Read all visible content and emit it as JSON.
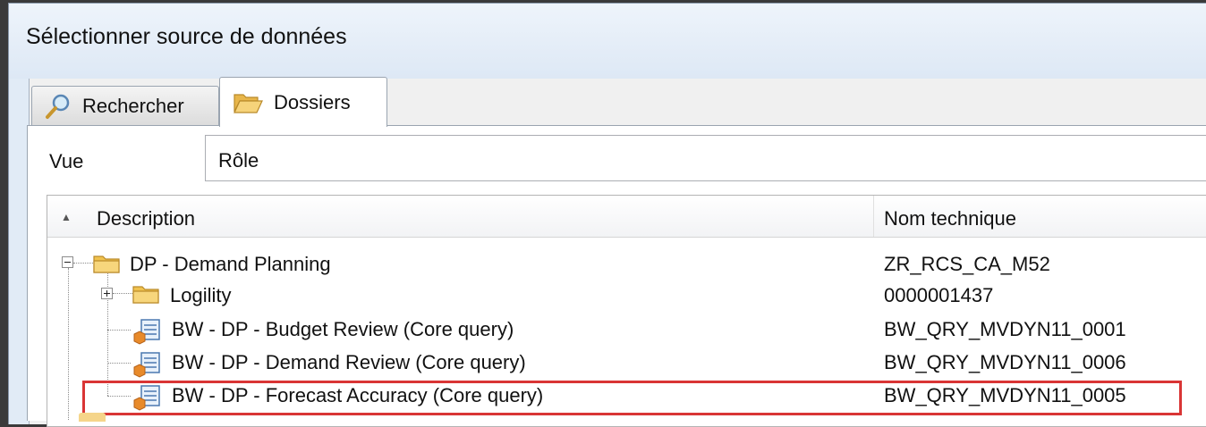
{
  "window": {
    "title": "Sélectionner source de données"
  },
  "tabs": [
    {
      "label": "Rechercher",
      "icon": "search-icon",
      "active": false
    },
    {
      "label": "Dossiers",
      "icon": "folder-open-icon",
      "active": true
    }
  ],
  "view": {
    "label": "Vue",
    "value": "Rôle"
  },
  "grid": {
    "columns": [
      {
        "label": "Description",
        "sort": "ascending"
      },
      {
        "label": "Nom technique"
      }
    ],
    "rows": [
      {
        "description": "DP - Demand Planning",
        "technical_name": "ZR_RCS_CA_M52",
        "type": "folder",
        "expanded": true,
        "level": 0
      },
      {
        "description": "Logility",
        "technical_name": "0000001437",
        "type": "folder",
        "expanded": false,
        "level": 1
      },
      {
        "description": "BW - DP - Budget Review (Core query)",
        "technical_name": "BW_QRY_MVDYN11_0001",
        "type": "query",
        "level": 1
      },
      {
        "description": "BW - DP - Demand Review (Core query)",
        "technical_name": "BW_QRY_MVDYN11_0006",
        "type": "query",
        "level": 1
      },
      {
        "description": "BW - DP - Forecast Accuracy (Core query)",
        "technical_name": "BW_QRY_MVDYN11_0005",
        "type": "query",
        "level": 1,
        "highlighted": true
      }
    ]
  },
  "colors": {
    "highlight": "#d93535",
    "window_bg": "#e1ebf6",
    "folder": "#f0c24e"
  }
}
